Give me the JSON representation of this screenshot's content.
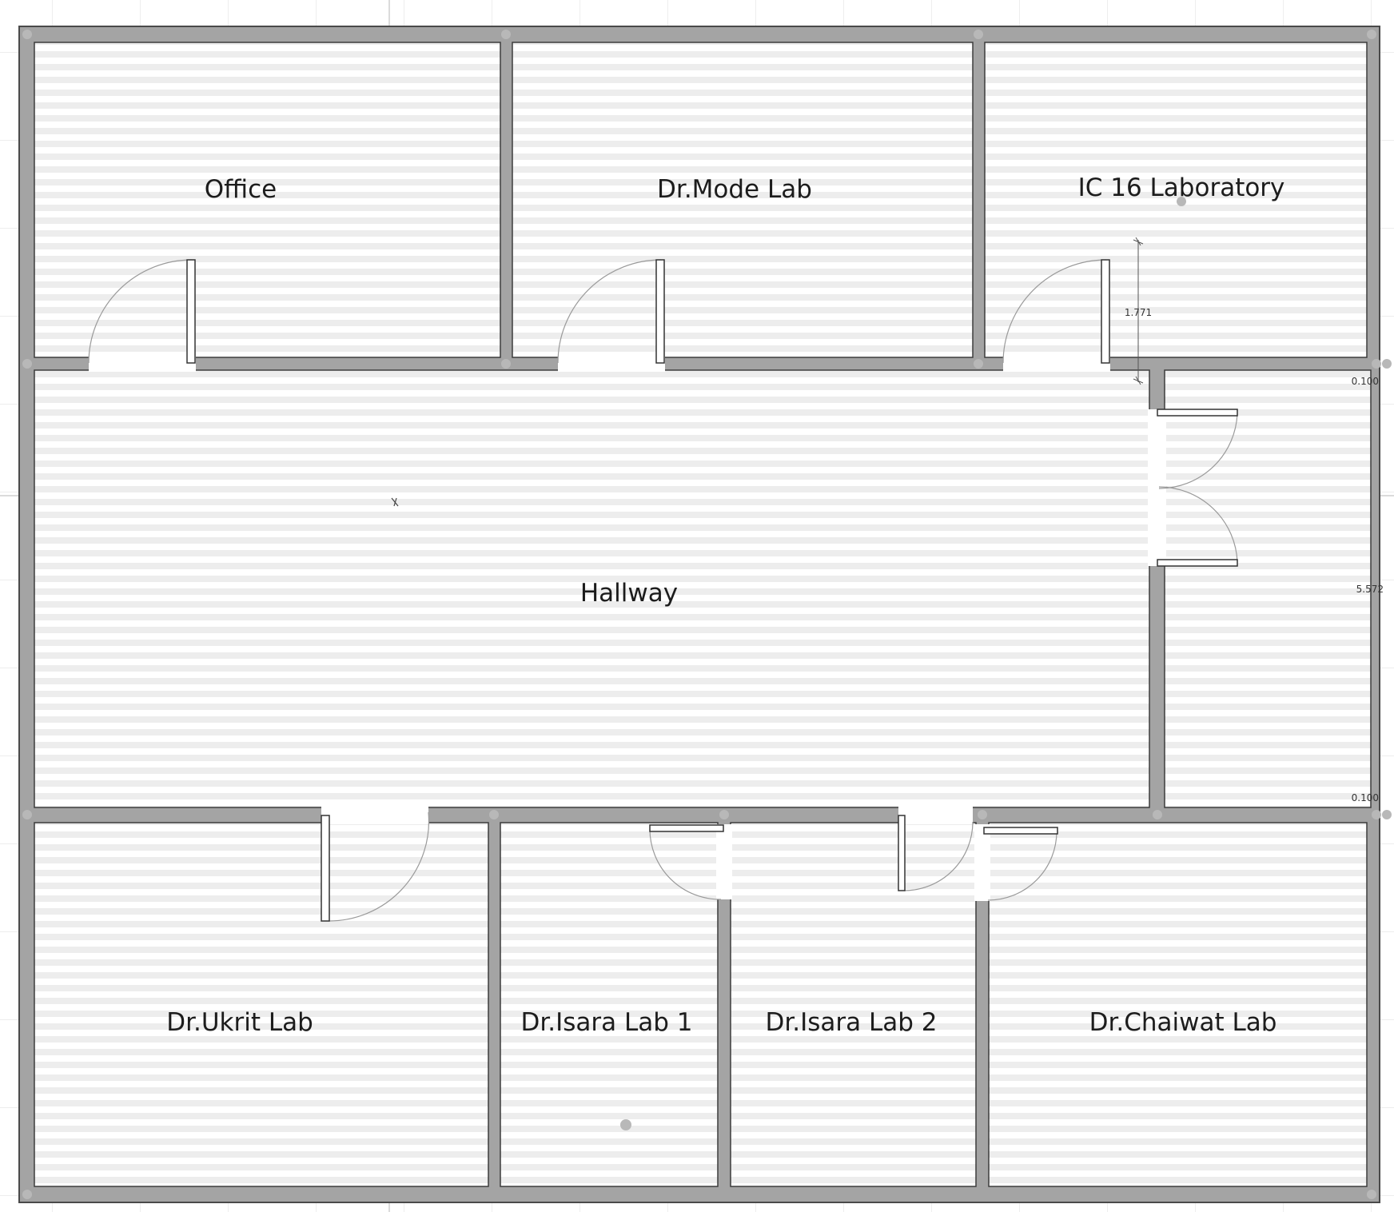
{
  "rooms": {
    "office": "Office",
    "mode_lab": "Dr.Mode Lab",
    "ic16_lab": "IC 16 Laboratory",
    "hallway": "Hallway",
    "ukrit_lab": "Dr.Ukrit Lab",
    "isara_lab_1": "Dr.Isara Lab 1",
    "isara_lab_2": "Dr.Isara Lab 2",
    "chaiwat_lab": "Dr.Chaiwat Lab"
  },
  "dimensions": {
    "ic16_door_height": "1.771",
    "wall_top_thickness": "0.100",
    "east_room_height": "5.572",
    "wall_bottom_thickness": "0.100"
  },
  "colors": {
    "wall": "#a4a4a4",
    "wall_outline": "#4a4a4a",
    "floor_stripe": "#ececec",
    "grid": "#e3e3e3"
  }
}
